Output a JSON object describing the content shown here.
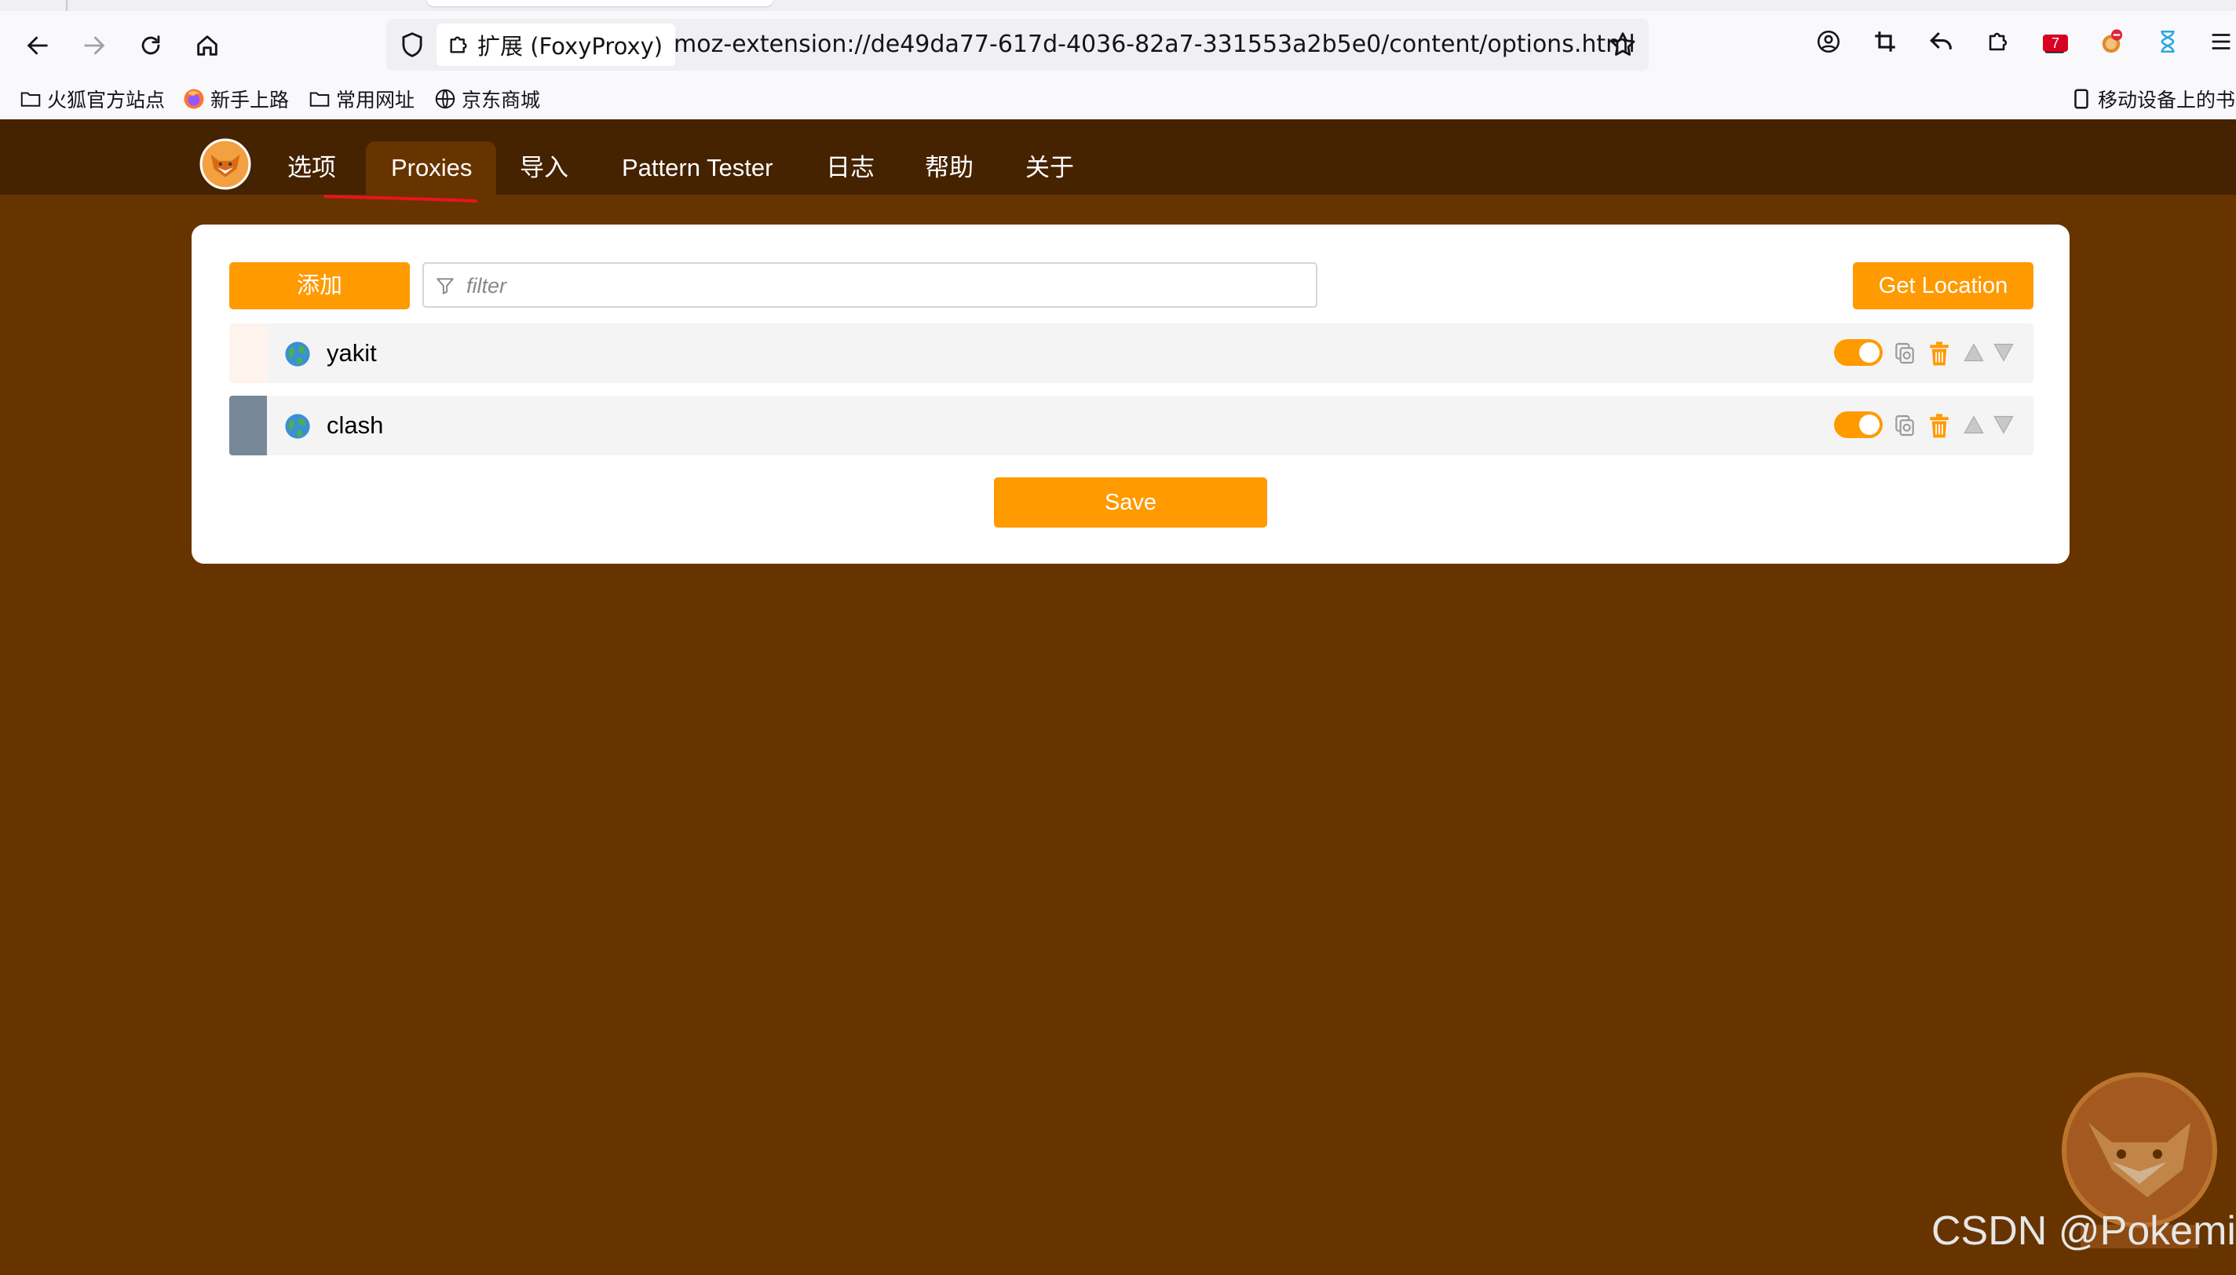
{
  "browser": {
    "tab_title": "",
    "url_chip": "扩展 (FoxyProxy)",
    "url": "moz-extension://de49da77-617d-4036-82a7-331553a2b5e0/content/options.html",
    "notification_count": "7",
    "bookmarks": [
      {
        "label": "火狐官方站点",
        "icon": "folder-icon"
      },
      {
        "label": "新手上路",
        "icon": "firefox-icon"
      },
      {
        "label": "常用网址",
        "icon": "folder-icon"
      },
      {
        "label": "京东商城",
        "icon": "globe-icon"
      }
    ],
    "mobile_bookmarks": "移动设备上的书签"
  },
  "app": {
    "nav": [
      {
        "label": "选项",
        "active": false
      },
      {
        "label": "Proxies",
        "active": true
      },
      {
        "label": "导入",
        "active": false
      },
      {
        "label": "Pattern Tester",
        "active": false
      },
      {
        "label": "日志",
        "active": false
      },
      {
        "label": "帮助",
        "active": false
      },
      {
        "label": "关于",
        "active": false
      }
    ],
    "colors": {
      "header_bg": "#452200",
      "page_bg": "#673400",
      "accent": "#ff9a00"
    }
  },
  "proxies": {
    "add_label": "添加",
    "filter_placeholder": "filter",
    "get_location_label": "Get Location",
    "save_label": "Save",
    "items": [
      {
        "name": "yakit",
        "color": "#fff3ee",
        "enabled": true
      },
      {
        "name": "clash",
        "color": "#778899",
        "enabled": true
      }
    ]
  },
  "watermark": {
    "text": "CSDN @Pokemi"
  }
}
